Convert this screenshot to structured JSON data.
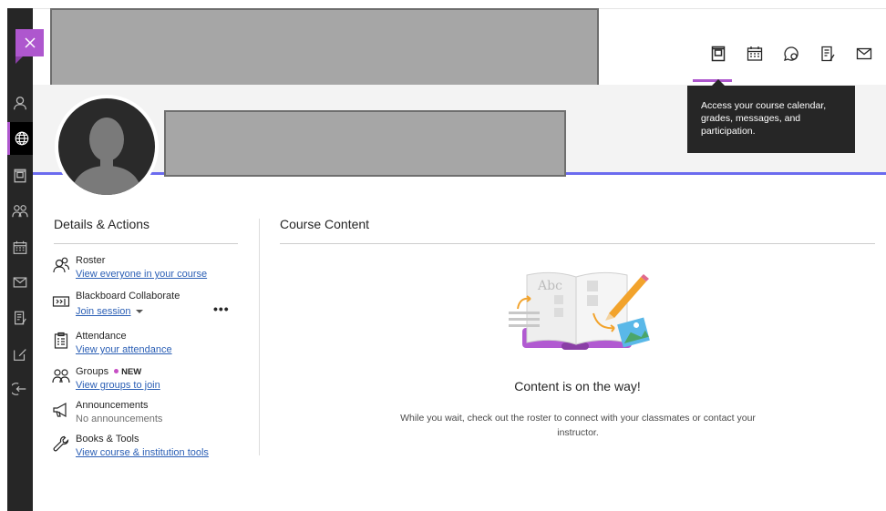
{
  "close": {
    "icon": "close-icon"
  },
  "rail": {
    "items": [
      {
        "icon": "user-icon"
      },
      {
        "icon": "globe-icon"
      },
      {
        "icon": "course-book-icon"
      },
      {
        "icon": "groups-icon"
      },
      {
        "icon": "calendar-icon"
      },
      {
        "icon": "mail-icon"
      },
      {
        "icon": "grades-icon"
      },
      {
        "icon": "edit-icon"
      },
      {
        "icon": "sign-out-icon"
      }
    ]
  },
  "top_icons": [
    {
      "icon": "course-book-icon"
    },
    {
      "icon": "calendar-icon"
    },
    {
      "icon": "discussions-icon"
    },
    {
      "icon": "grades-icon"
    },
    {
      "icon": "messages-icon"
    }
  ],
  "tooltip": {
    "text": "Access your course calendar, grades, messages, and participation."
  },
  "details": {
    "title": "Details & Actions",
    "roster": {
      "title": "Roster",
      "link": "View everyone in your course"
    },
    "collaborate": {
      "title": "Blackboard Collaborate",
      "link": "Join session"
    },
    "attendance": {
      "title": "Attendance",
      "link": "View your attendance"
    },
    "groups": {
      "title": "Groups",
      "badge": "NEW",
      "link": "View groups to join"
    },
    "announcements": {
      "title": "Announcements",
      "sub": "No announcements"
    },
    "books": {
      "title": "Books & Tools",
      "link": "View course & institution tools"
    },
    "more": "•••"
  },
  "content": {
    "title": "Course Content",
    "empty_title": "Content is on the way!",
    "empty_desc": "While you wait, check out the roster to connect with your classmates or contact your instructor.",
    "illustration_text": "Abc"
  },
  "colors": {
    "accent": "#ae57ce",
    "banner_line": "#6b6bef",
    "link": "#2b5fb5",
    "rail": "#262626"
  }
}
